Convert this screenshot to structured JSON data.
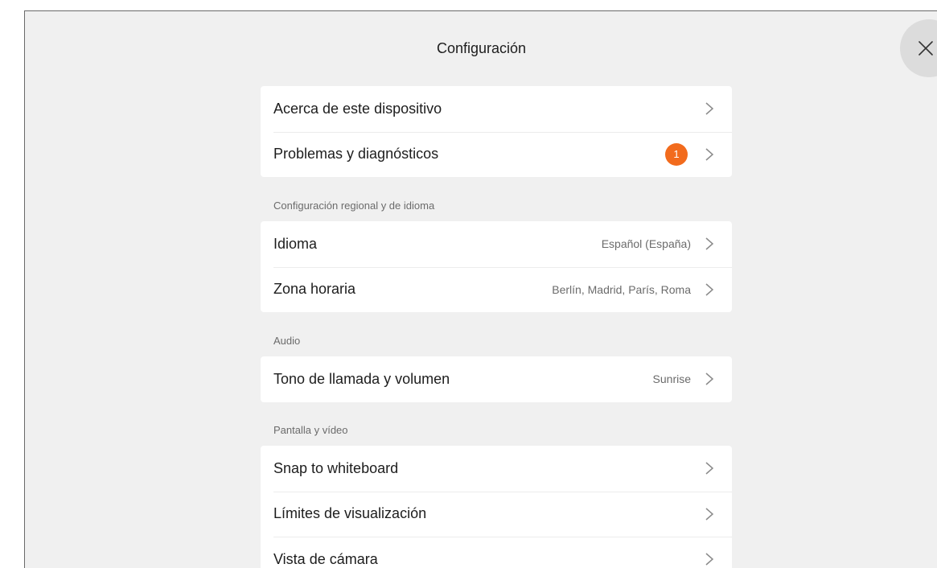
{
  "header": {
    "title": "Configuración"
  },
  "close_icon": "close-icon",
  "groups": [
    {
      "section_label": "",
      "items": [
        {
          "label": "Acerca de este dispositivo",
          "value": "",
          "badge": ""
        },
        {
          "label": "Problemas y diagnósticos",
          "value": "",
          "badge": "1"
        }
      ]
    },
    {
      "section_label": "Configuración regional y de idioma",
      "items": [
        {
          "label": "Idioma",
          "value": "Español (España)",
          "badge": ""
        },
        {
          "label": "Zona horaria",
          "value": "Berlín, Madrid, París, Roma",
          "badge": ""
        }
      ]
    },
    {
      "section_label": "Audio",
      "items": [
        {
          "label": "Tono de llamada y volumen",
          "value": "Sunrise",
          "badge": ""
        }
      ]
    },
    {
      "section_label": "Pantalla y vídeo",
      "items": [
        {
          "label": "Snap to whiteboard",
          "value": "",
          "badge": ""
        },
        {
          "label": "Límites de visualización",
          "value": "",
          "badge": ""
        },
        {
          "label": "Vista de cámara",
          "value": "",
          "badge": ""
        }
      ]
    }
  ],
  "colors": {
    "badge": "#f26b1d",
    "panel_bg": "#f0f0f0"
  }
}
